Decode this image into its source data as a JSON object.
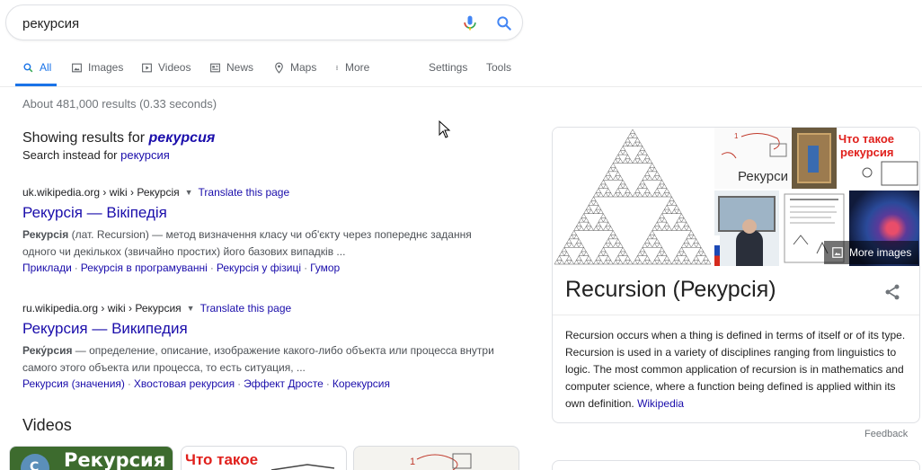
{
  "search": {
    "query": "рекурсия"
  },
  "tabs": [
    {
      "label": "All",
      "icon": "search-icon"
    },
    {
      "label": "Images",
      "icon": "image-icon"
    },
    {
      "label": "Videos",
      "icon": "video-icon"
    },
    {
      "label": "News",
      "icon": "news-icon"
    },
    {
      "label": "Maps",
      "icon": "map-pin-icon"
    },
    {
      "label": "More",
      "icon": "more-vert-icon"
    }
  ],
  "tools": {
    "settings": "Settings",
    "tools": "Tools"
  },
  "stats": "About 481,000 results (0.33 seconds)",
  "spell": {
    "showing_prefix": "Showing results for",
    "corrected": "рекурсия",
    "instead_prefix": "Search instead for",
    "original": "рекурсия"
  },
  "results": [
    {
      "url": "uk.wikipedia.org › wiki › Рекурсія",
      "translate": "Translate this page",
      "title": "Рекурсія — Вікіпедія",
      "snippet_bold": "Рекурсія",
      "snippet_rest": " (лат. Recursion) — метод визначення класу чи об'єкту через попереднє задання одного чи декількох (звичайно простих) його базових випадків ...",
      "links": [
        "Приклади",
        "Рекурсія в програмуванні",
        "Рекурсія у фізиці",
        "Гумор"
      ]
    },
    {
      "url": "ru.wikipedia.org › wiki › Рекурсия",
      "translate": "Translate this page",
      "title": "Рекурсия — Википедия",
      "snippet_bold": "Реку́рсия",
      "snippet_rest": " — определение, описание, изображение какого-либо объекта или процесса внутри самого этого объекта или процесса, то есть ситуация, ...",
      "links": [
        "Рекурсия (значения)",
        "Хвостовая рекурсия",
        "Эффект Дросте",
        "Корекурсия"
      ]
    }
  ],
  "videos": {
    "heading": "Videos",
    "thumb1_text": "Рекурсия",
    "thumb2_text": "Что такое"
  },
  "knowledge_panel": {
    "image_texts": {
      "rekursiya": "Рекурси",
      "chto_takoe": "Что такое",
      "rekursiya2": "рекурсия"
    },
    "more_images": "More images",
    "title": "Recursion (Рекурсія)",
    "description": "Recursion occurs when a thing is defined in terms of itself or of its type. Recursion is used in a variety of disciplines ranging from linguistics to logic. The most common application of recursion is in mathematics and computer science, where a function being defined is applied within its own definition.",
    "source": "Wikipedia"
  },
  "feedback": "Feedback",
  "colors": {
    "link": "#1a0dab",
    "accent": "#1a73e8",
    "muted": "#70757a"
  }
}
